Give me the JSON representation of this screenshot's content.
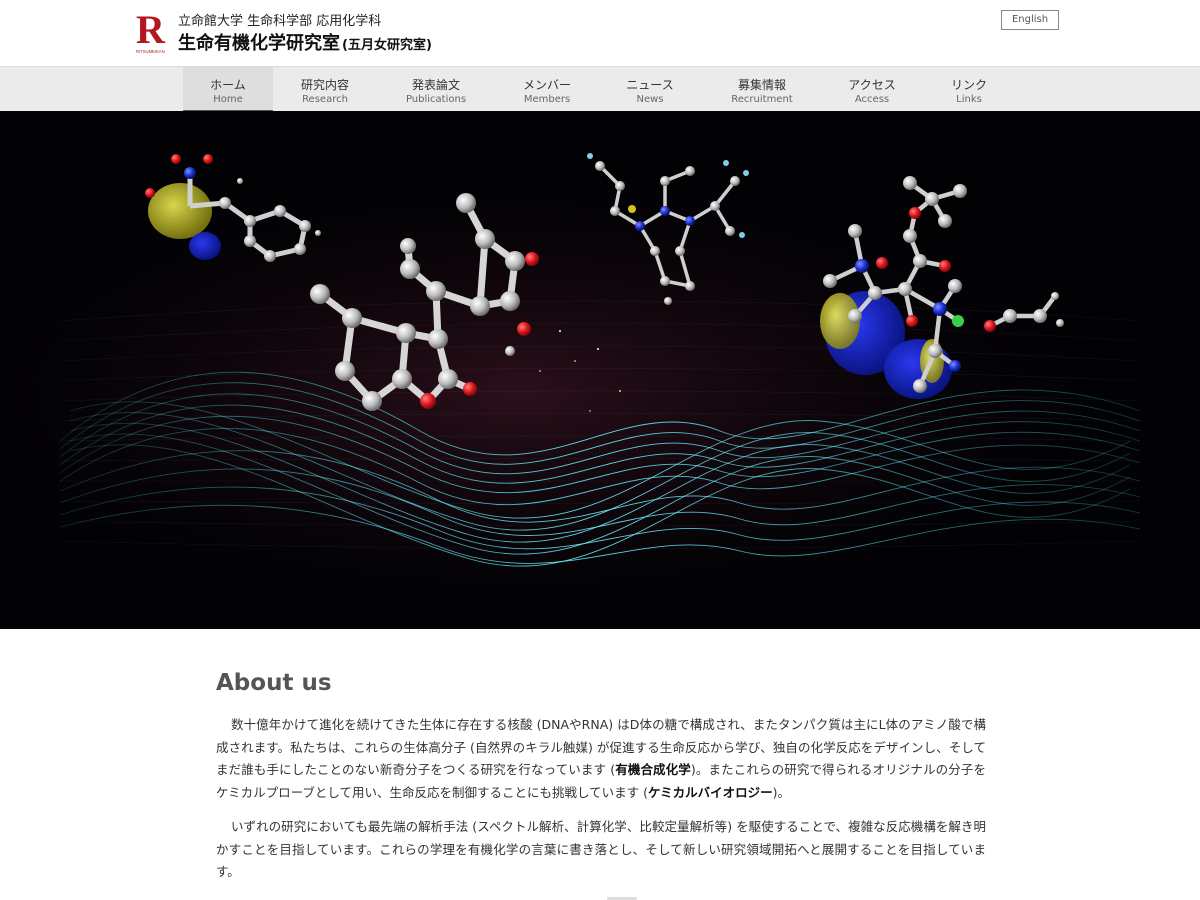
{
  "header": {
    "university_line": "立命館大学 生命科学部 応用化学科",
    "lab_name": "生命有機化学研究室",
    "lab_sub": "(五月女研究室)",
    "logo_letter": "R",
    "logo_text": "RITSUMEIKAN",
    "language_button": "English"
  },
  "nav": {
    "items": [
      {
        "jp": "ホーム",
        "en": "Home"
      },
      {
        "jp": "研究内容",
        "en": "Research"
      },
      {
        "jp": "発表論文",
        "en": "Publications"
      },
      {
        "jp": "メンバー",
        "en": "Members"
      },
      {
        "jp": "ニュース",
        "en": "News"
      },
      {
        "jp": "募集情報",
        "en": "Recruitment"
      },
      {
        "jp": "アクセス",
        "en": "Access"
      },
      {
        "jp": "リンク",
        "en": "Links"
      }
    ],
    "active_index": 0
  },
  "about": {
    "title": "About us",
    "p1_a": "数十億年かけて進化を続けてきた生体に存在する核酸 (DNAやRNA) はD体の糖で構成され、またタンパク質は主にL体のアミノ酸で構成されます。私たちは、これらの生体高分子 (自然界のキラル触媒) が促進する生命反応から学び、独自の化学反応をデザインし、そしてまだ誰も手にしたことのない新奇分子をつくる研究を行なっています (",
    "p1_b1": "有機合成化学",
    "p1_c": ")。またこれらの研究で得られるオリジナルの分子をケミカルプローブとして用い、生命反応を制御することにも挑戦しています (",
    "p1_b2": "ケミカルバイオロジー",
    "p1_d": ")。",
    "p2": "いずれの研究においても最先端の解析手法 (スペクトル解析、計算化学、比較定量解析等) を駆使することで、複雑な反応機構を解き明かすことを目指しています。これらの学理を有機化学の言葉に書き落とし、そして新しい研究領域開拓へと展開することを目指しています。"
  },
  "colors": {
    "logo_red": "#b3171f",
    "nav_bg": "#ebebeb",
    "hero_bg": "#020205",
    "wave_cyan": "#4fe6f0",
    "oxygen_red": "#e0141b",
    "nitrogen_blue": "#1a2fd6",
    "orbital_yellow": "#c9c21a"
  }
}
